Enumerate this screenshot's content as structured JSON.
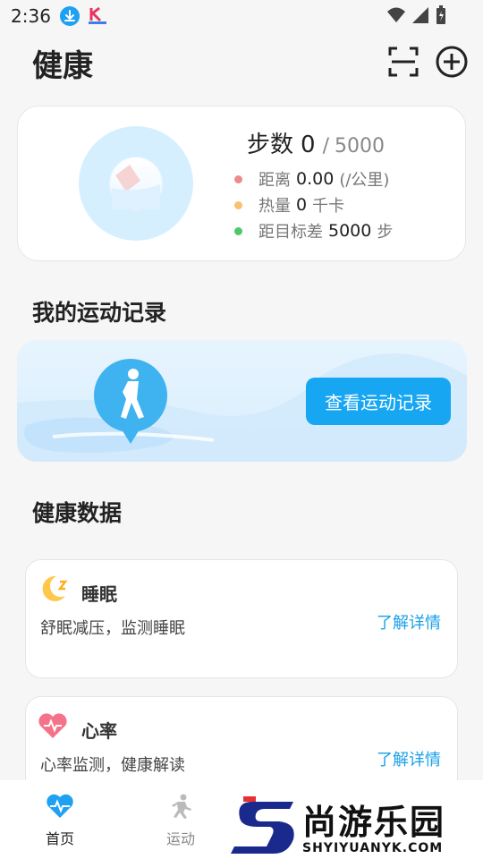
{
  "status_bar": {
    "time": "2:36"
  },
  "header": {
    "title": "健康"
  },
  "steps_card": {
    "label": "步数",
    "value": "0",
    "separator": "/",
    "goal": "5000",
    "metrics": [
      {
        "label": "距离",
        "value": "0.00",
        "unit": "(/公里)",
        "color": "#f08a8a"
      },
      {
        "label": "热量",
        "value": "0",
        "unit": "千卡",
        "color": "#f7c16d"
      },
      {
        "label": "距目标差",
        "value": "5000",
        "unit": "步",
        "color": "#4fc86a"
      }
    ]
  },
  "records": {
    "title": "我的运动记录",
    "button_label": "查看运动记录"
  },
  "health": {
    "title": "健康数据",
    "cards": [
      {
        "title": "睡眠",
        "desc": "舒眠减压，监测睡眠",
        "link": "了解详情"
      },
      {
        "title": "心率",
        "desc": "心率监测，健康解读",
        "link": "了解详情"
      }
    ]
  },
  "bottom_nav": {
    "items": [
      {
        "label": "首页",
        "active": true
      },
      {
        "label": "运动",
        "active": false
      }
    ],
    "active_color": "#1ea1f2",
    "inactive_color": "#888888"
  },
  "watermark": {
    "text": "尚游乐园",
    "sub": "SHYIYUANYK.COM"
  }
}
